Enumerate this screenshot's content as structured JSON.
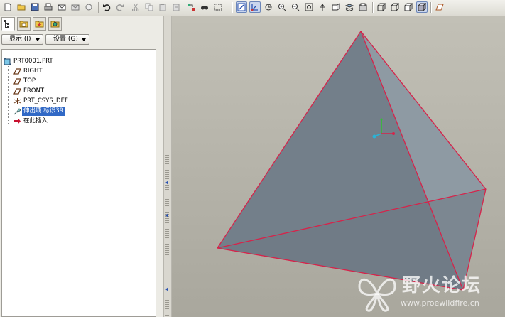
{
  "toolbar": {
    "buttons": [
      {
        "icon": "new-file-icon"
      },
      {
        "icon": "open-folder-icon"
      },
      {
        "icon": "save-icon"
      },
      {
        "icon": "print-icon"
      },
      {
        "icon": "email-icon"
      },
      {
        "icon": "email-link-icon"
      },
      {
        "icon": "undo-icon"
      },
      {
        "icon": "redo-icon"
      },
      {
        "icon": "cut-icon"
      },
      {
        "icon": "copy-icon"
      },
      {
        "icon": "paste-icon"
      },
      {
        "icon": "paste-special-icon"
      },
      {
        "icon": "regenerate-icon"
      },
      {
        "icon": "find-icon"
      },
      {
        "icon": "selection-box-icon"
      },
      {
        "icon": "repaint-icon"
      },
      {
        "icon": "spin-center-icon"
      },
      {
        "icon": "orient-icon"
      },
      {
        "icon": "zoom-in-icon"
      },
      {
        "icon": "zoom-out-icon"
      },
      {
        "icon": "refit-icon"
      },
      {
        "icon": "reorient-icon"
      },
      {
        "icon": "saved-views-icon"
      },
      {
        "icon": "layers-icon"
      },
      {
        "icon": "view-manager-icon"
      },
      {
        "icon": "wireframe-icon"
      },
      {
        "icon": "hidden-line-icon"
      },
      {
        "icon": "no-hidden-icon"
      },
      {
        "icon": "shading-icon"
      },
      {
        "icon": "datum-planes-icon"
      }
    ]
  },
  "navigator": {
    "tabs": [
      {
        "icon": "model-tree-icon",
        "active": true
      },
      {
        "icon": "folder-browser-icon",
        "active": false
      },
      {
        "icon": "favorites-icon",
        "active": false
      },
      {
        "icon": "connections-icon",
        "active": false
      }
    ],
    "show_label": "显示 (I)",
    "settings_label": "设置 (G)",
    "tree": {
      "root": "PRT0001.PRT",
      "items": [
        {
          "label": "RIGHT",
          "icon": "datum-plane-icon"
        },
        {
          "label": "TOP",
          "icon": "datum-plane-icon"
        },
        {
          "label": "FRONT",
          "icon": "datum-plane-icon"
        },
        {
          "label": "PRT_CSYS_DEF",
          "icon": "coordinate-system-icon"
        },
        {
          "label": "伸出项 标识39",
          "icon": "protrusion-icon",
          "selected": true
        },
        {
          "label": "在此插入",
          "icon": "insert-here-arrow-icon"
        }
      ]
    }
  },
  "watermark": {
    "title": "野火论坛",
    "url": "www.proewildfire.cn"
  },
  "colors": {
    "edge": "#d6234a",
    "face_dark": "#737f8a",
    "face_light": "#8e9aa3",
    "viewport_top": "#c2c0b6",
    "viewport_bottom": "#a9a79d",
    "selection": "#3169c6"
  }
}
